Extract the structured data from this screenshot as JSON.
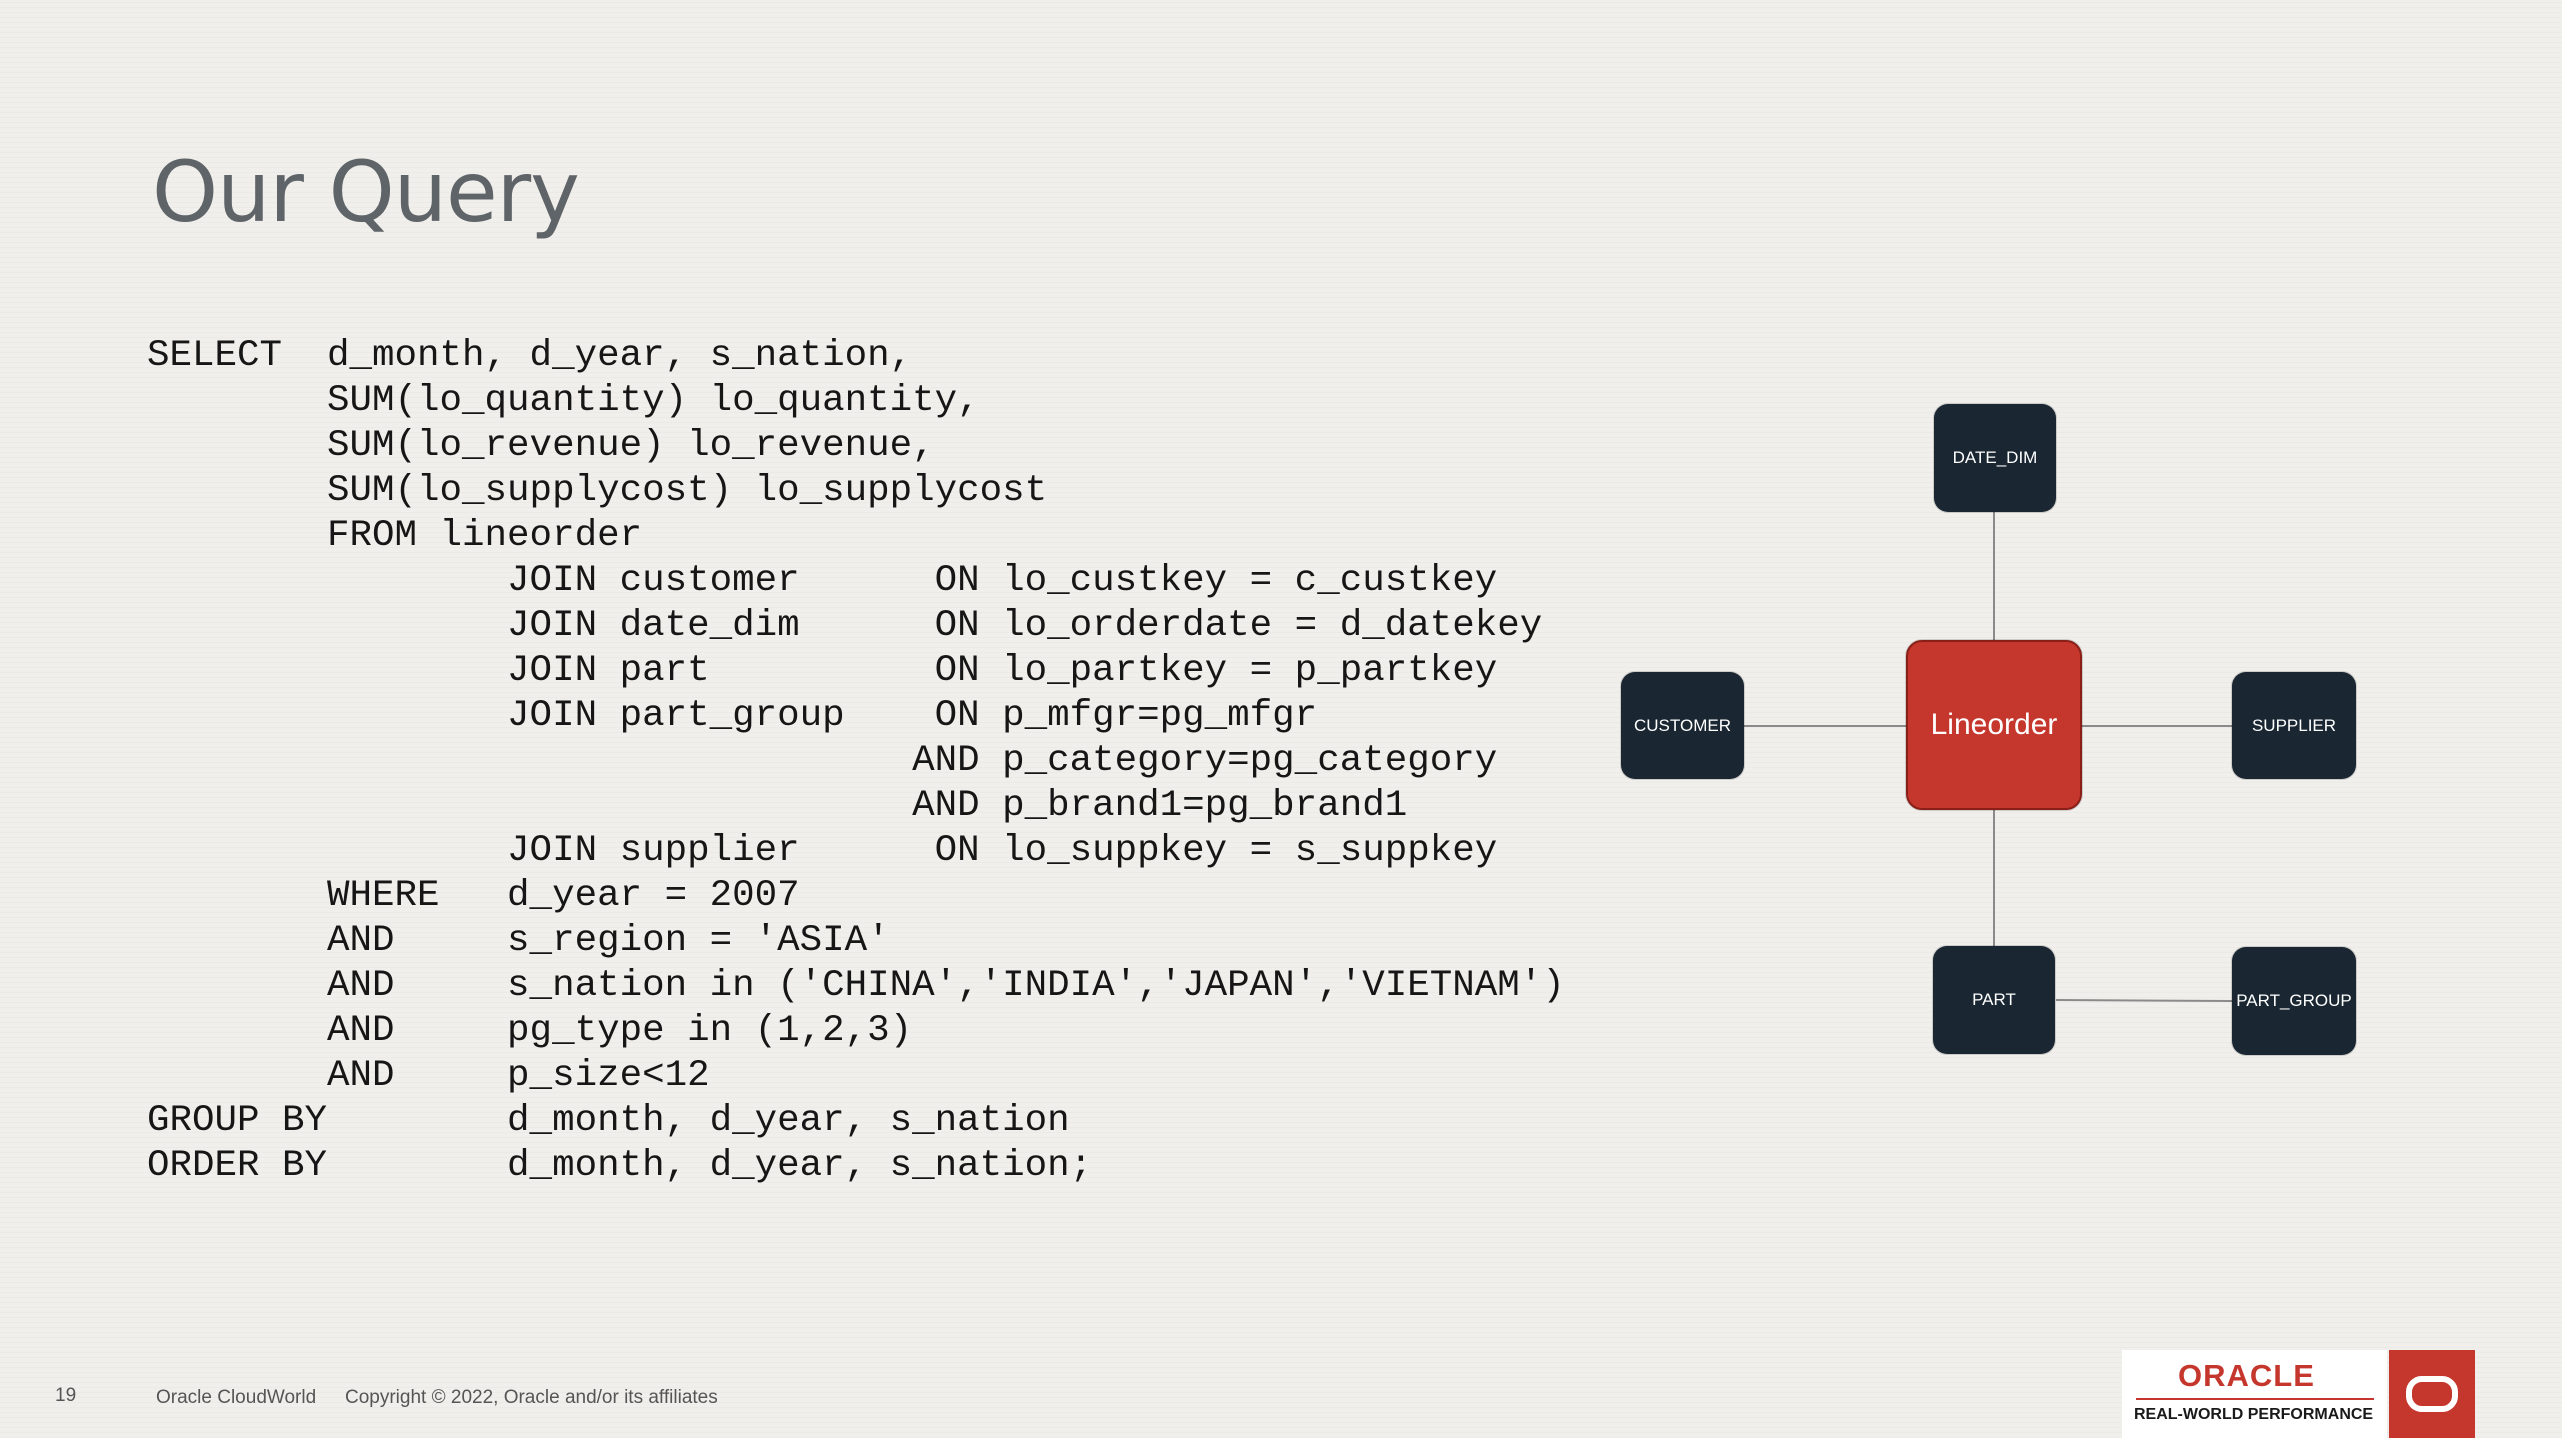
{
  "slide": {
    "title": "Our Query"
  },
  "sql_lines": [
    "SELECT  d_month, d_year, s_nation,",
    "        SUM(lo_quantity) lo_quantity,",
    "        SUM(lo_revenue) lo_revenue,",
    "        SUM(lo_supplycost) lo_supplycost",
    "        FROM lineorder",
    "                JOIN customer      ON lo_custkey = c_custkey",
    "                JOIN date_dim      ON lo_orderdate = d_datekey",
    "                JOIN part          ON lo_partkey = p_partkey",
    "                JOIN part_group    ON p_mfgr=pg_mfgr",
    "                                  AND p_category=pg_category",
    "                                  AND p_brand1=pg_brand1",
    "                JOIN supplier      ON lo_suppkey = s_suppkey",
    "        WHERE   d_year = 2007",
    "        AND     s_region = 'ASIA'",
    "        AND     s_nation in ('CHINA','INDIA','JAPAN','VIETNAM')",
    "        AND     pg_type in (1,2,3)",
    "        AND     p_size<12",
    "GROUP BY        d_month, d_year, s_nation",
    "ORDER BY        d_month, d_year, s_nation;"
  ],
  "diagram": {
    "fact": "Lineorder",
    "date_dim": "DATE_DIM",
    "customer": "CUSTOMER",
    "supplier": "SUPPLIER",
    "part": "PART",
    "part_group": "PART_GROUP"
  },
  "footer": {
    "page_number": "19",
    "brand": "Oracle CloudWorld",
    "copyright": "Copyright © 2022, Oracle and/or its affiliates"
  },
  "logo": {
    "name": "ORACLE",
    "tagline": "REAL-WORLD PERFORMANCE",
    "icon": "oracle-o-icon"
  },
  "colors": {
    "fact_node": "#c5372d",
    "dimension_node": "#1a2733",
    "background": "#f0efeb"
  }
}
